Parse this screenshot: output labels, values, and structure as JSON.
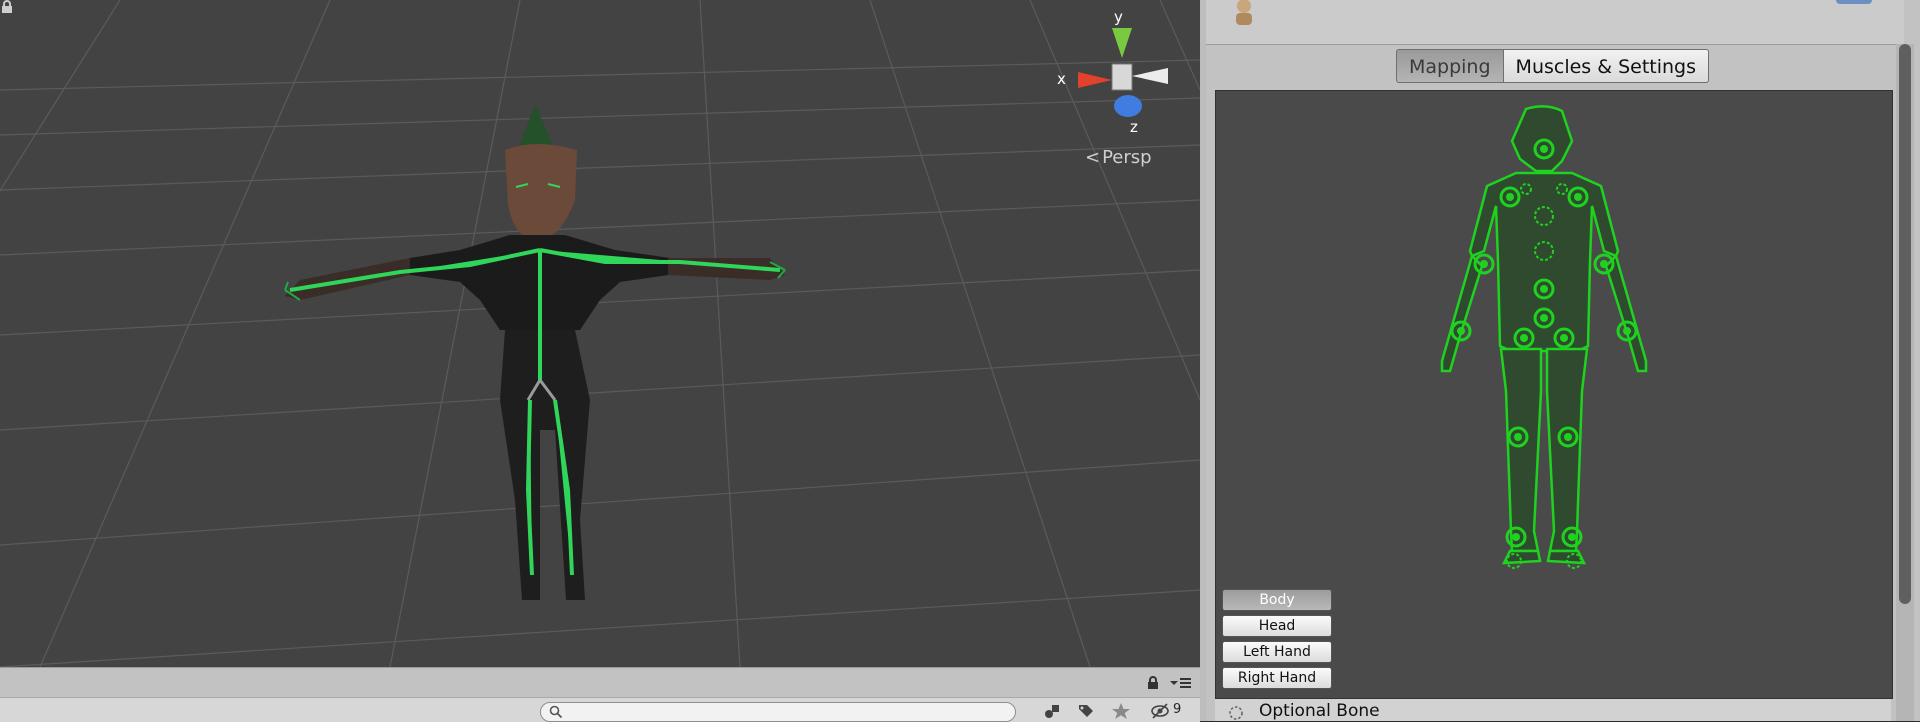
{
  "scene": {
    "projection_label": "Persp",
    "gizmo": {
      "x_label": "x",
      "y_label": "y",
      "z_label": "z"
    },
    "colors": {
      "background": "#434343",
      "grid": "#5a5a5a",
      "bone": "#2fd65a"
    }
  },
  "project_toolbar": {
    "search_placeholder": "",
    "hidden_count": "9"
  },
  "inspector": {
    "tabs": [
      {
        "label": "Mapping",
        "active": true
      },
      {
        "label": "Muscles & Settings",
        "active": false
      }
    ],
    "view_buttons": [
      {
        "label": "Body",
        "active": true
      },
      {
        "label": "Head",
        "active": false
      },
      {
        "label": "Left Hand",
        "active": false
      },
      {
        "label": "Right Hand",
        "active": false
      }
    ],
    "legend": {
      "optional_bone_label": "Optional Bone"
    },
    "colors": {
      "panel_bg": "#4a4a4a",
      "figure_outline": "#1fd21f",
      "figure_fill": "#2f4a2f"
    }
  }
}
